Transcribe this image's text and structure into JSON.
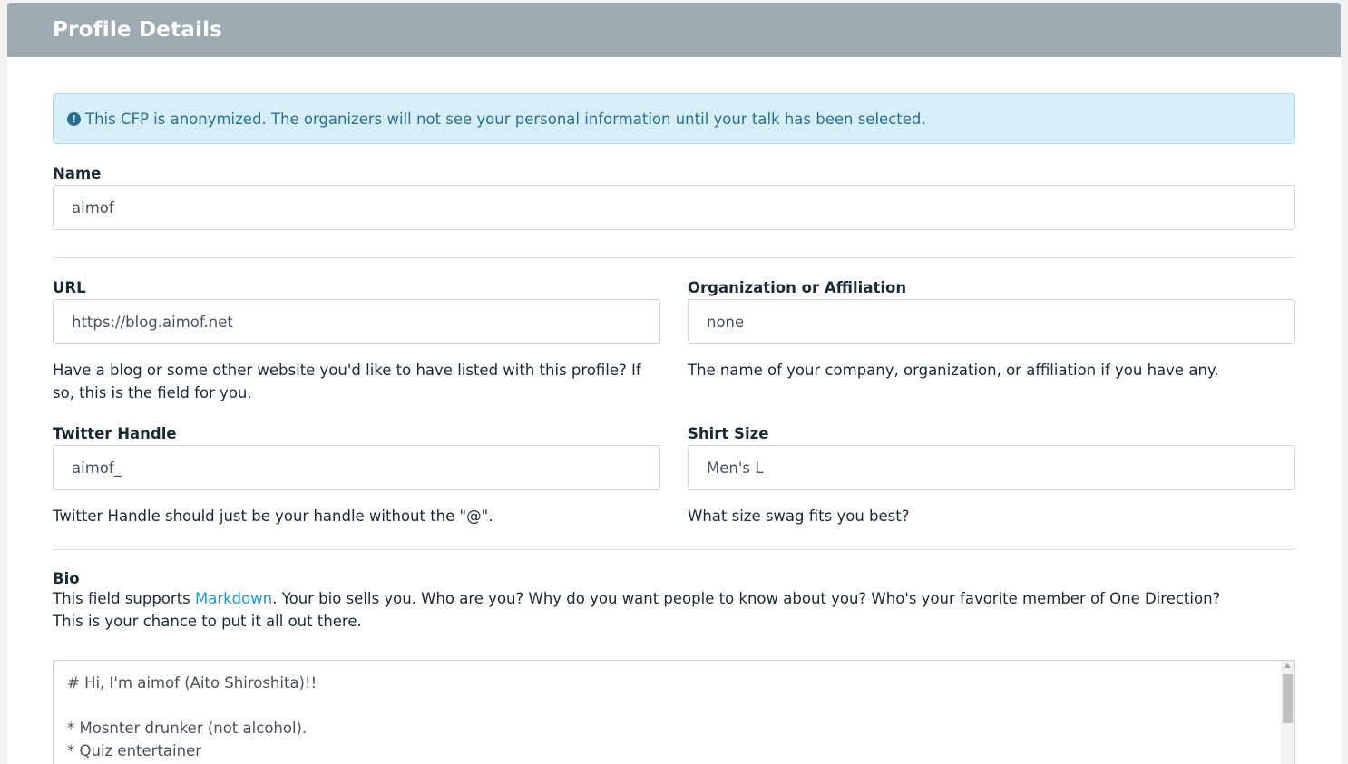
{
  "header": {
    "title": "Profile Details"
  },
  "alert": {
    "icon": "exclamation-circle-icon",
    "text": "This CFP is anonymized. The organizers will not see your personal information until your talk has been selected."
  },
  "name": {
    "label": "Name",
    "value": "aimof"
  },
  "url": {
    "label": "URL",
    "value": "https://blog.aimof.net",
    "help": "Have a blog or some other website you'd like to have listed with this profile? If so, this is the field for you."
  },
  "organization": {
    "label": "Organization or Affiliation",
    "value": "none",
    "help": "The name of your company, organization, or affiliation if you have any."
  },
  "twitter": {
    "label": "Twitter Handle",
    "value": "aimof_",
    "help": "Twitter Handle should just be your handle without the \"@\"."
  },
  "shirt": {
    "label": "Shirt Size",
    "value": "Men's L",
    "help": "What size swag fits you best?"
  },
  "bio": {
    "label": "Bio",
    "help_prefix": "This field supports ",
    "help_link": "Markdown",
    "help_suffix": ". Your bio sells you. Who are you? Why do you want people to know about you? Who's your favorite member of One Direction?",
    "help_line2": "This is your chance to put it all out there.",
    "content": "# Hi, I'm aimof (Aito Shiroshita)!!\n\n* Mosnter drunker (not alcohol).\n* Quiz entertainer"
  }
}
